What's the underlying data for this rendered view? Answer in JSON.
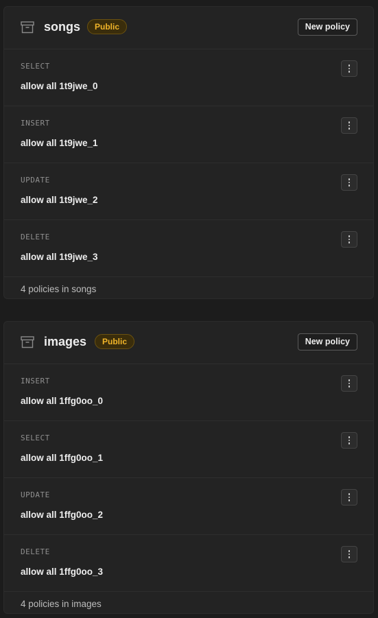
{
  "tables": [
    {
      "name": "songs",
      "badge": "Public",
      "new_policy_label": "New policy",
      "policies": [
        {
          "command": "SELECT",
          "name": "allow all 1t9jwe_0"
        },
        {
          "command": "INSERT",
          "name": "allow all 1t9jwe_1"
        },
        {
          "command": "UPDATE",
          "name": "allow all 1t9jwe_2"
        },
        {
          "command": "DELETE",
          "name": "allow all 1t9jwe_3"
        }
      ],
      "footer": "4 policies in songs"
    },
    {
      "name": "images",
      "badge": "Public",
      "new_policy_label": "New policy",
      "policies": [
        {
          "command": "INSERT",
          "name": "allow all 1ffg0oo_0"
        },
        {
          "command": "SELECT",
          "name": "allow all 1ffg0oo_1"
        },
        {
          "command": "UPDATE",
          "name": "allow all 1ffg0oo_2"
        },
        {
          "command": "DELETE",
          "name": "allow all 1ffg0oo_3"
        }
      ],
      "footer": "4 policies in images"
    }
  ],
  "icons": {
    "table": "archive-icon",
    "row_menu": "more-vertical-icon"
  },
  "colors": {
    "badge_text": "#f0b429",
    "badge_bg": "#3a2d0b",
    "background": "#1c1c1c",
    "card": "#232323"
  }
}
